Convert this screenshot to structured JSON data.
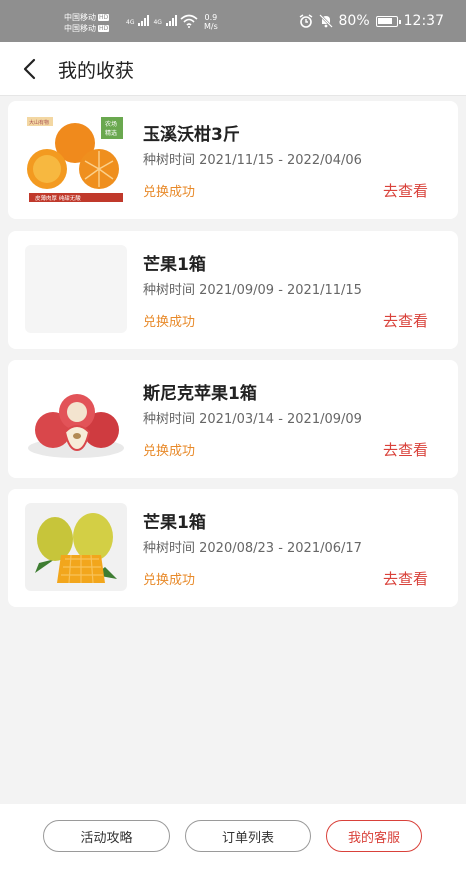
{
  "status_bar": {
    "carrier_1": "中国移动",
    "carrier_2": "中国移动",
    "hd_1": "HD",
    "hd_2": "HD",
    "sim_1_type": "4G",
    "sim_2_type": "4G",
    "net_speed_value": "0.9",
    "net_speed_unit": "M/s",
    "battery": "80%",
    "time": "12:37"
  },
  "nav": {
    "title": "我的收获"
  },
  "harvests": [
    {
      "title": "玉溪沃柑3斤",
      "time": "种树时间 2021/11/15 - 2022/04/06",
      "status": "兑换成功",
      "action": "去查看",
      "image": "orange",
      "image_text": {
        "brand": "大山有物",
        "badge_1": "农场",
        "badge_2": "精选",
        "caption": "皮薄肉厚   纯甜无酸"
      }
    },
    {
      "title": "芒果1箱",
      "time": "种树时间 2021/09/09 - 2021/11/15",
      "status": "兑换成功",
      "action": "去查看",
      "image": "blank"
    },
    {
      "title": "斯尼克苹果1箱",
      "time": "种树时间 2021/03/14 - 2021/09/09",
      "status": "兑换成功",
      "action": "去查看",
      "image": "apple"
    },
    {
      "title": "芒果1箱",
      "time": "种树时间 2020/08/23 - 2021/06/17",
      "status": "兑换成功",
      "action": "去查看",
      "image": "mango"
    }
  ],
  "bottom": {
    "activity_guide": "活动攻略",
    "order_list": "订单列表",
    "customer_service": "我的客服"
  },
  "colors": {
    "accent": "#d9413a",
    "status": "#e88a2a",
    "background": "#f3f3f3"
  }
}
